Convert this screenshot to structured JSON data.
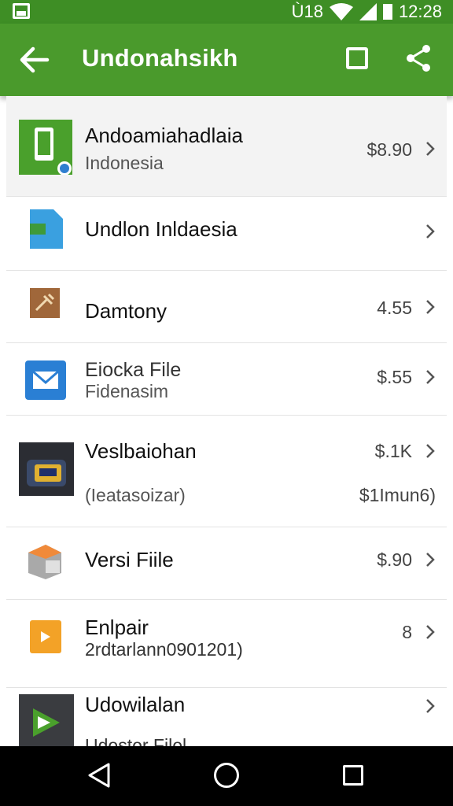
{
  "status_bar": {
    "left_icon": "image-icon",
    "indicators": "Ù18",
    "time": "12:28"
  },
  "app_bar": {
    "title": "Undonahsikh",
    "back_icon": "arrow-left-icon",
    "square_icon": "square-icon",
    "share_icon": "share-icon"
  },
  "items": [
    {
      "title": "Andoamiahadlaia",
      "subtitle": "Indonesia",
      "price": "$8.90",
      "icon": "phone-app-icon"
    },
    {
      "title": "Undlon Inldaesia",
      "subtitle": "",
      "price": "",
      "icon": "document-icon"
    },
    {
      "title": "Damtony",
      "subtitle": "",
      "price": "4.55",
      "icon": "tool-icon"
    },
    {
      "title": "Eiocka File",
      "subtitle": "Fidenasim",
      "price": "$.55",
      "icon": "mail-icon"
    },
    {
      "title": "Veslbaiohan",
      "subtitle": "(Ieatasoizar)",
      "price": "$.1K",
      "price2": "$1Imun6)",
      "icon": "device-photo-icon"
    },
    {
      "title": "Versi Fiile",
      "subtitle": "",
      "price": "$.90",
      "icon": "box-icon"
    },
    {
      "title": "Enlpair",
      "subtitle": "2rdtarlann0901201)",
      "price": "8",
      "icon": "orange-file-icon"
    },
    {
      "title": "Udowilalan",
      "subtitle": "Udostor Filol",
      "price": "",
      "icon": "play-icon"
    }
  ],
  "nav_bar": {
    "back": "triangle-back-icon",
    "home": "circle-home-icon",
    "recent": "square-recent-icon"
  }
}
